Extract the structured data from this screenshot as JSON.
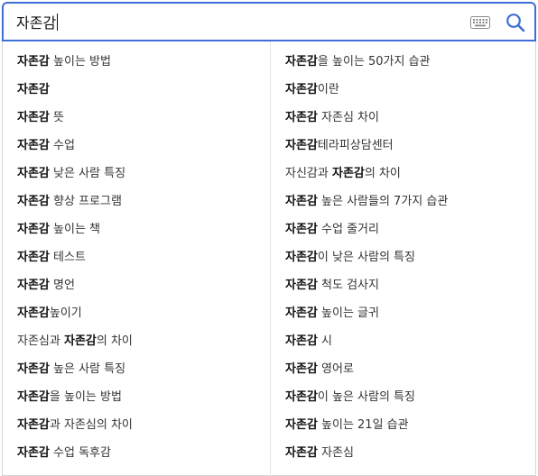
{
  "search": {
    "query": "자존감",
    "keyboard_icon": "keyboard-icon",
    "search_icon": "search-icon",
    "accent_color": "#3f6fd6"
  },
  "suggestions_left": [
    [
      {
        "t": "자존감",
        "b": true
      },
      {
        "t": " 높이는 방법",
        "b": false
      }
    ],
    [
      {
        "t": "자존감",
        "b": true
      }
    ],
    [
      {
        "t": "자존감",
        "b": true
      },
      {
        "t": " 뜻",
        "b": false
      }
    ],
    [
      {
        "t": "자존감",
        "b": true
      },
      {
        "t": " 수업",
        "b": false
      }
    ],
    [
      {
        "t": "자존감",
        "b": true
      },
      {
        "t": " 낮은 사람 특징",
        "b": false
      }
    ],
    [
      {
        "t": "자존감",
        "b": true
      },
      {
        "t": " 향상 프로그램",
        "b": false
      }
    ],
    [
      {
        "t": "자존감",
        "b": true
      },
      {
        "t": " 높이는 책",
        "b": false
      }
    ],
    [
      {
        "t": "자존감",
        "b": true
      },
      {
        "t": " 테스트",
        "b": false
      }
    ],
    [
      {
        "t": "자존감",
        "b": true
      },
      {
        "t": " 명언",
        "b": false
      }
    ],
    [
      {
        "t": "자존감",
        "b": true
      },
      {
        "t": "높이기",
        "b": false
      }
    ],
    [
      {
        "t": "자존심과 ",
        "b": false
      },
      {
        "t": "자존감",
        "b": true
      },
      {
        "t": "의 차이",
        "b": false
      }
    ],
    [
      {
        "t": "자존감",
        "b": true
      },
      {
        "t": " 높은 사람 특징",
        "b": false
      }
    ],
    [
      {
        "t": "자존감",
        "b": true
      },
      {
        "t": "을 높이는 방법",
        "b": false
      }
    ],
    [
      {
        "t": "자존감",
        "b": true
      },
      {
        "t": "과 자존심의 차이",
        "b": false
      }
    ],
    [
      {
        "t": "자존감",
        "b": true
      },
      {
        "t": " 수업 독후감",
        "b": false
      }
    ]
  ],
  "suggestions_right": [
    [
      {
        "t": "자존감",
        "b": true
      },
      {
        "t": "을 높이는 50가지 습관",
        "b": false
      }
    ],
    [
      {
        "t": "자존감",
        "b": true
      },
      {
        "t": "이란",
        "b": false
      }
    ],
    [
      {
        "t": "자존감",
        "b": true
      },
      {
        "t": " 자존심 차이",
        "b": false
      }
    ],
    [
      {
        "t": "자존감",
        "b": true
      },
      {
        "t": "테라피상담센터",
        "b": false
      }
    ],
    [
      {
        "t": "자신감과 ",
        "b": false
      },
      {
        "t": "자존감",
        "b": true
      },
      {
        "t": "의 차이",
        "b": false
      }
    ],
    [
      {
        "t": "자존감",
        "b": true
      },
      {
        "t": " 높은 사람들의 7가지 습관",
        "b": false
      }
    ],
    [
      {
        "t": "자존감",
        "b": true
      },
      {
        "t": " 수업 줄거리",
        "b": false
      }
    ],
    [
      {
        "t": "자존감",
        "b": true
      },
      {
        "t": "이 낮은 사람의 특징",
        "b": false
      }
    ],
    [
      {
        "t": "자존감",
        "b": true
      },
      {
        "t": " 척도 검사지",
        "b": false
      }
    ],
    [
      {
        "t": "자존감",
        "b": true
      },
      {
        "t": " 높이는 글귀",
        "b": false
      }
    ],
    [
      {
        "t": "자존감",
        "b": true
      },
      {
        "t": " 시",
        "b": false
      }
    ],
    [
      {
        "t": "자존감",
        "b": true
      },
      {
        "t": " 영어로",
        "b": false
      }
    ],
    [
      {
        "t": "자존감",
        "b": true
      },
      {
        "t": "이 높은 사람의 특징",
        "b": false
      }
    ],
    [
      {
        "t": "자존감",
        "b": true
      },
      {
        "t": " 높이는 21일 습관",
        "b": false
      }
    ],
    [
      {
        "t": "자존감",
        "b": true
      },
      {
        "t": " 자존심",
        "b": false
      }
    ]
  ]
}
